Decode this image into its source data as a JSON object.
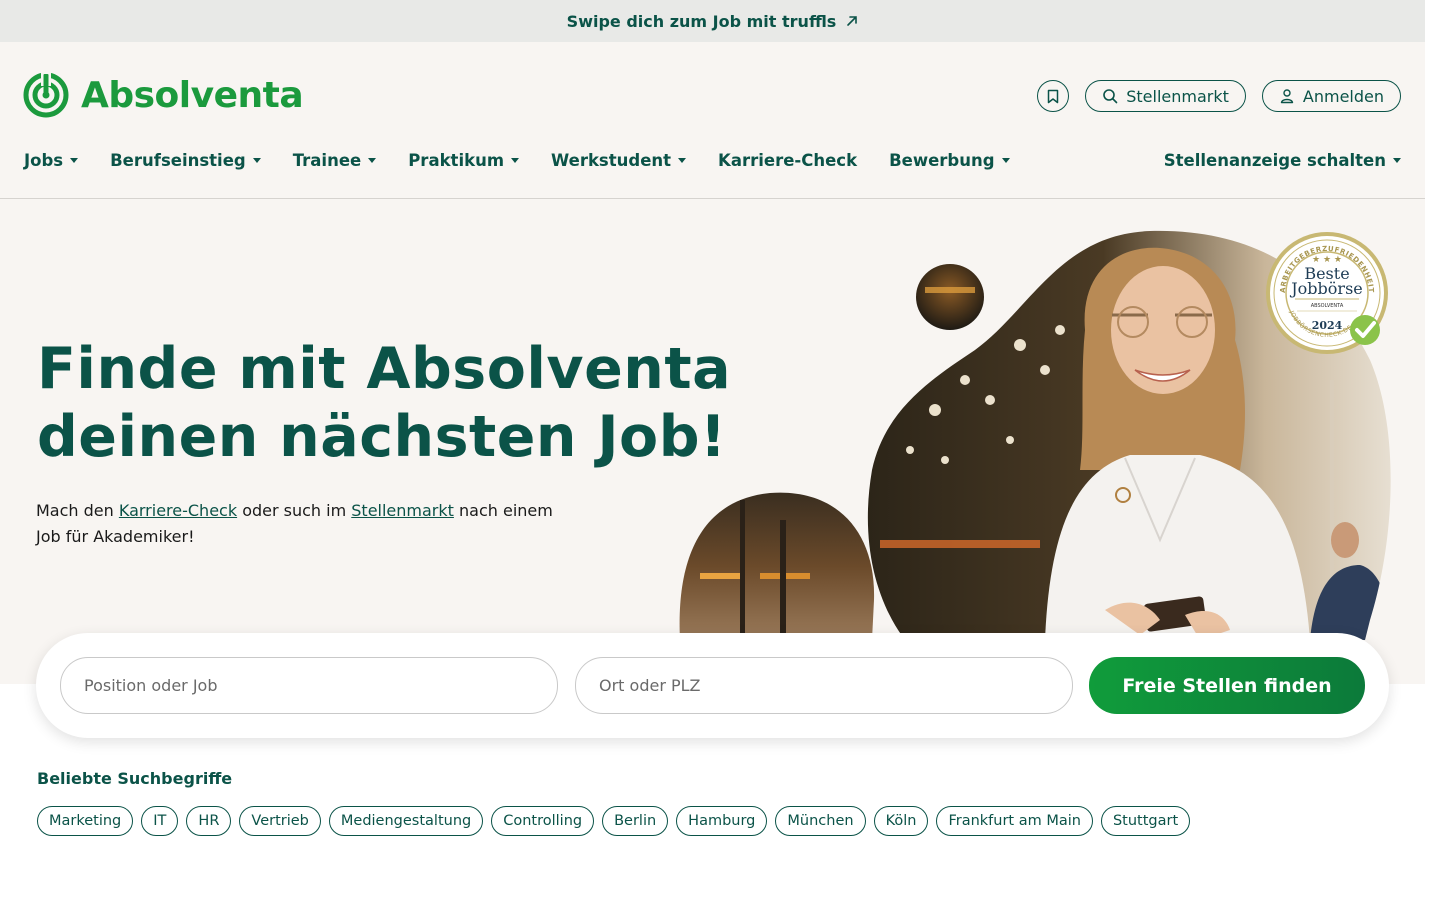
{
  "banner": {
    "text": "Swipe dich zum Job mit truffls",
    "icon": "arrow-up-right-icon"
  },
  "header": {
    "brand": "Absolventa",
    "actions": {
      "bookmark_icon": "bookmark-icon",
      "jobmarket_label": "Stellenmarkt",
      "login_label": "Anmelden"
    },
    "nav": [
      {
        "label": "Jobs",
        "dropdown": true
      },
      {
        "label": "Berufseinstieg",
        "dropdown": true
      },
      {
        "label": "Trainee",
        "dropdown": true
      },
      {
        "label": "Praktikum",
        "dropdown": true
      },
      {
        "label": "Werkstudent",
        "dropdown": true
      },
      {
        "label": "Karriere-Check",
        "dropdown": false
      },
      {
        "label": "Bewerbung",
        "dropdown": true
      }
    ],
    "nav_right": {
      "label": "Stellenanzeige schalten",
      "dropdown": true
    }
  },
  "hero": {
    "title_line1": "Finde mit Absolventa",
    "title_line2": "deinen nächsten Job!",
    "sub_part1": "Mach den ",
    "sub_link1": "Karriere-Check",
    "sub_part2": " oder such im ",
    "sub_link2": "Stellenmarkt",
    "sub_part3": " nach einem Job für Akademiker!",
    "badge": {
      "arc_text": "ARBEITGEBERZUFRIEDENHEIT",
      "line1": "Beste",
      "line2": "Jobbörse",
      "brand": "ABSOLVENTA",
      "year": "2024",
      "bottom_arc": "JOBBÖRSENCHECK.DE"
    }
  },
  "search": {
    "position_placeholder": "Position oder Job",
    "location_placeholder": "Ort oder PLZ",
    "button_label": "Freie Stellen finden"
  },
  "popular": {
    "title": "Beliebte Suchbegriffe",
    "tags": [
      "Marketing",
      "IT",
      "HR",
      "Vertrieb",
      "Mediengestaltung",
      "Controlling",
      "Berlin",
      "Hamburg",
      "München",
      "Köln",
      "Frankfurt am Main",
      "Stuttgart"
    ]
  },
  "colors": {
    "brand_green": "#1b9a3d",
    "dark_teal": "#0b5348",
    "hero_bg": "#f8f5f2",
    "banner_bg": "#e8e9e7"
  }
}
